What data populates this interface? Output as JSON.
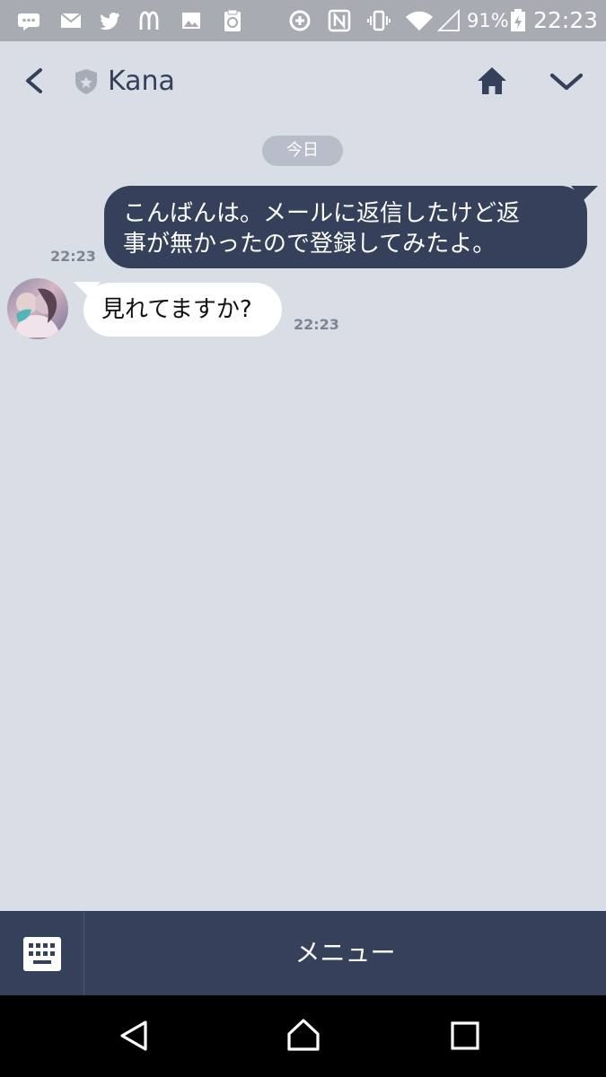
{
  "status_bar": {
    "battery_percent": "91%",
    "time": "22:23",
    "icons": [
      "chat-bubble-icon",
      "mail-icon",
      "twitter-bird-icon",
      "mcdonalds-logo-icon",
      "image-icon",
      "clipboard-icon",
      "data-saver-icon",
      "nfc-icon",
      "vibrate-icon",
      "wifi-icon",
      "signal-icon",
      "battery-charging-icon"
    ]
  },
  "header": {
    "title": "Kana",
    "icons": [
      "back-icon",
      "official-shield-icon",
      "home-icon",
      "chevron-down-icon"
    ]
  },
  "chat": {
    "date_label": "今日",
    "messages": [
      {
        "direction": "outgoing",
        "text_line_1": "こんばんは。メールに返信したけど返",
        "text_line_2": "事が無かったので登録してみたよ。",
        "time": "22:23"
      },
      {
        "direction": "incoming",
        "text": "見れてますか?",
        "time": "22:23"
      }
    ]
  },
  "bottom_bar": {
    "menu_label": "メニュー",
    "keyboard_icon": "keyboard-icon"
  },
  "navigation_bar": {
    "icons": [
      "nav-back-icon",
      "nav-home-icon",
      "nav-recent-icon"
    ]
  },
  "colors": {
    "status_bar_background": "#a8abb2",
    "chat_background": "#d8dde6",
    "brand_dark": "#35415a",
    "incoming_bubble": "#ffffff",
    "timestamp": "#7d8595",
    "navigation_bar": "#000000"
  }
}
